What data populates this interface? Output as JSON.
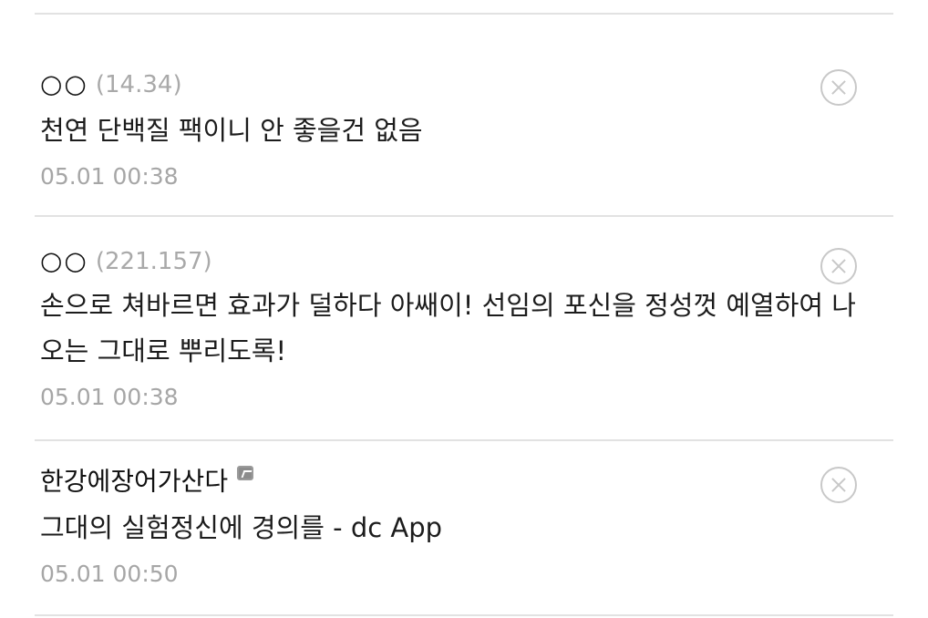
{
  "comments": [
    {
      "author": "○○",
      "ip": "(14.34)",
      "text": "천연 단백질 팩이니 안 좋을건 없음",
      "time": "05.01 00:38"
    },
    {
      "author": "○○",
      "ip": "(221.157)",
      "text": "손으로 쳐바르면 효과가 덜하다 아쌔이! 선임의 포신을 정성껏 예열하여 나오는 그대로 뿌리도록!",
      "time": "05.01 00:38"
    },
    {
      "author": "한강에장어가산다",
      "ip": "",
      "text": "그대의 실험정신에 경의를 - dc App",
      "time": "05.01 00:50"
    }
  ]
}
